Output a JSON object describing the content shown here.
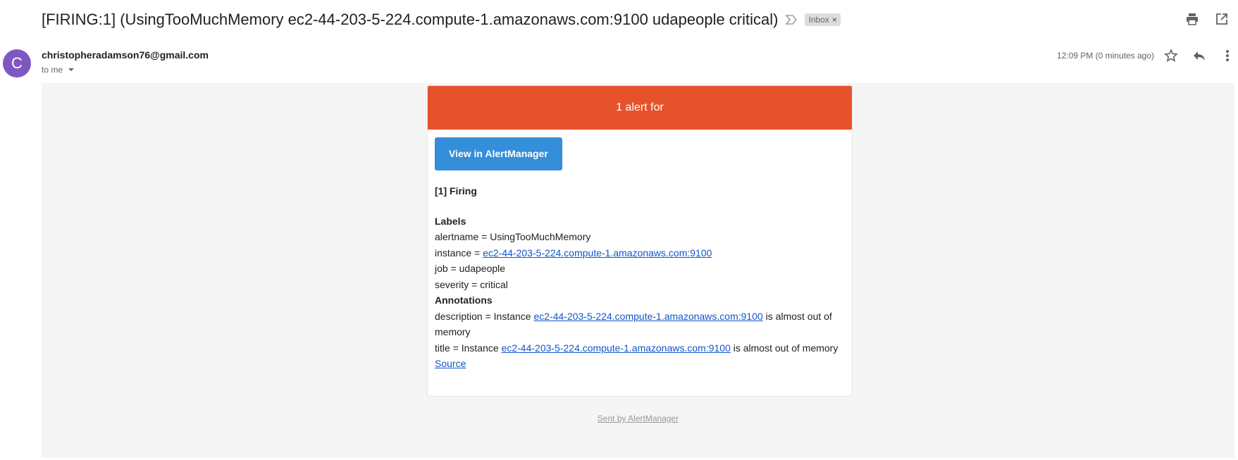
{
  "header": {
    "subject": "[FIRING:1] (UsingTooMuchMemory ec2-44-203-5-224.compute-1.amazonaws.com:9100 udapeople critical)",
    "inbox_label": "Inbox",
    "chip_close": "×",
    "icons": [
      "importance-icon",
      "print-icon",
      "open-in-new-window-icon"
    ]
  },
  "message": {
    "avatar_letter": "C",
    "avatar_color": "#7e57c2",
    "sender": "christopheradamson76@gmail.com",
    "to": "to me",
    "timestamp": "12:09 PM (0 minutes ago)",
    "icons": [
      "star-icon",
      "reply-icon",
      "more-icon"
    ]
  },
  "email": {
    "banner": "1 alert for",
    "banner_color": "#e6522c",
    "button": "View in AlertManager",
    "button_color": "#348eda",
    "firing": "[1] Firing",
    "labels_heading": "Labels",
    "alertname": "alertname = UsingTooMuchMemory",
    "instance_prefix": "instance = ",
    "instance_link": "ec2-44-203-5-224.compute-1.amazonaws.com:9100",
    "job": "job = udapeople",
    "severity": "severity = critical",
    "annotations_heading": "Annotations",
    "description_prefix": "description = Instance ",
    "description_link": "ec2-44-203-5-224.compute-1.amazonaws.com:9100",
    "description_suffix": " is almost out of memory",
    "title_prefix": "title = Instance ",
    "title_link": "ec2-44-203-5-224.compute-1.amazonaws.com:9100",
    "title_suffix": " is almost out of memory",
    "source": "Source",
    "footer": "Sent by AlertManager"
  }
}
